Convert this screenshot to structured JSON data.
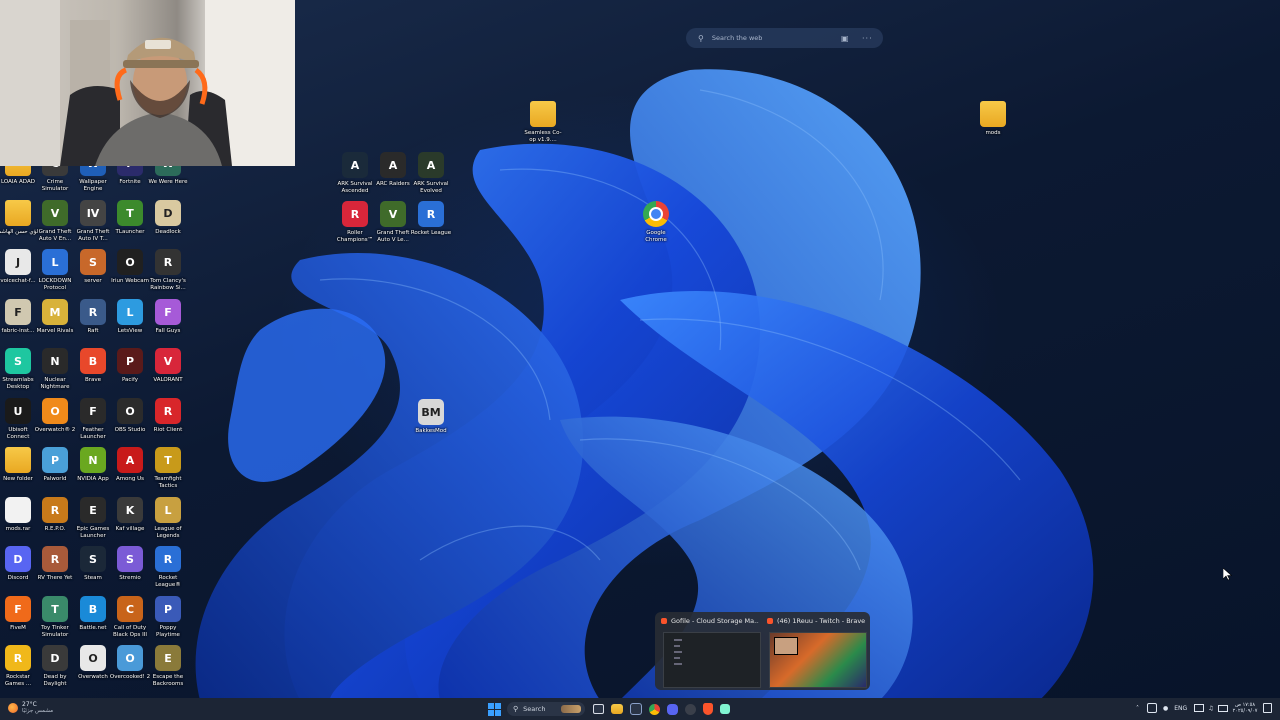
{
  "desktop_icons_left": [
    {
      "label": "LOAIA ADAD",
      "color": "#e9a822",
      "glyph": "",
      "kind": "folder"
    },
    {
      "label": "Crime Simulator",
      "color": "#3a3a3a",
      "glyph": "C"
    },
    {
      "label": "Wallpaper Engine",
      "color": "#1f5fb8",
      "glyph": "W"
    },
    {
      "label": "Fortnite",
      "color": "#2b2b6b",
      "glyph": "F"
    },
    {
      "label": "We Were Here",
      "color": "#2c6b5a",
      "glyph": "W"
    },
    {
      "label": "لؤي حسن الهاشم",
      "color": "#e9a822",
      "glyph": "",
      "kind": "folder"
    },
    {
      "label": "Grand Theft Auto V En...",
      "color": "#3f6b2a",
      "glyph": "V"
    },
    {
      "label": "Grand Theft Auto IV T...",
      "color": "#444444",
      "glyph": "IV"
    },
    {
      "label": "TLauncher",
      "color": "#3c8a2c",
      "glyph": "T"
    },
    {
      "label": "Deadlock",
      "color": "#d9c9a0",
      "glyph": "D"
    },
    {
      "label": "voicechat-f...",
      "color": "#e8e8e8",
      "glyph": "J"
    },
    {
      "label": "LOCKDOWN Protocol",
      "color": "#2a6fd6",
      "glyph": "L"
    },
    {
      "label": "server",
      "color": "#c8682a",
      "glyph": "S"
    },
    {
      "label": "Iriun Webcam",
      "color": "#202020",
      "glyph": "O"
    },
    {
      "label": "Tom Clancy's Rainbow Si...",
      "color": "#333333",
      "glyph": "R"
    },
    {
      "label": "fabric-inst...",
      "color": "#d0c8b0",
      "glyph": "F"
    },
    {
      "label": "Marvel Rivals",
      "color": "#d8b23a",
      "glyph": "M"
    },
    {
      "label": "Raft",
      "color": "#3a5a8a",
      "glyph": "R"
    },
    {
      "label": "LetsView",
      "color": "#2d9be0",
      "glyph": "L"
    },
    {
      "label": "Fall Guys",
      "color": "#a65ad8",
      "glyph": "F"
    },
    {
      "label": "Streamlabs Desktop",
      "color": "#1ec7a0",
      "glyph": "S"
    },
    {
      "label": "Nuclear Nightmare",
      "color": "#2a2a2a",
      "glyph": "N"
    },
    {
      "label": "Brave",
      "color": "#e8482b",
      "glyph": "B"
    },
    {
      "label": "Pacify",
      "color": "#5a1a1a",
      "glyph": "P"
    },
    {
      "label": "VALORANT",
      "color": "#d8263a",
      "glyph": "V"
    },
    {
      "label": "Ubisoft Connect",
      "color": "#1a1a1a",
      "glyph": "U"
    },
    {
      "label": "Overwatch® 2",
      "color": "#f08a1a",
      "glyph": "O"
    },
    {
      "label": "Feather Launcher",
      "color": "#2a2a2a",
      "glyph": "F"
    },
    {
      "label": "OBS Studio",
      "color": "#2b2b2b",
      "glyph": "O"
    },
    {
      "label": "Riot Client",
      "color": "#d8262a",
      "glyph": "R"
    },
    {
      "label": "New folder",
      "color": "#e9a822",
      "glyph": "",
      "kind": "folder"
    },
    {
      "label": "Palworld",
      "color": "#4aa0d8",
      "glyph": "P"
    },
    {
      "label": "NVIDIA App",
      "color": "#6aa820",
      "glyph": "N"
    },
    {
      "label": "Among Us",
      "color": "#c81a1a",
      "glyph": "A"
    },
    {
      "label": "Teamfight Tactics",
      "color": "#c89a1a",
      "glyph": "T"
    },
    {
      "label": "mods.rar",
      "color": "#f2f2f2",
      "glyph": ""
    },
    {
      "label": "R.E.P.O.",
      "color": "#c87a1a",
      "glyph": "R"
    },
    {
      "label": "Epic Games Launcher",
      "color": "#2a2a2a",
      "glyph": "E"
    },
    {
      "label": "Kaf village",
      "color": "#3a3a3a",
      "glyph": "K"
    },
    {
      "label": "League of Legends",
      "color": "#c8a040",
      "glyph": "L"
    },
    {
      "label": "Discord",
      "color": "#5865f2",
      "glyph": "D"
    },
    {
      "label": "RV There Yet",
      "color": "#a85a3a",
      "glyph": "R"
    },
    {
      "label": "Steam",
      "color": "#1b2838",
      "glyph": "S"
    },
    {
      "label": "Stremio",
      "color": "#7b5bd6",
      "glyph": "S"
    },
    {
      "label": "Rocket League®",
      "color": "#2a6fd6",
      "glyph": "R"
    },
    {
      "label": "FiveM",
      "color": "#f06a1a",
      "glyph": "F"
    },
    {
      "label": "Toy Tinker Simulator",
      "color": "#3a8a6a",
      "glyph": "T"
    },
    {
      "label": "Battle.net",
      "color": "#1a8ad8",
      "glyph": "B"
    },
    {
      "label": "Call of Duty Black Ops III",
      "color": "#c8641a",
      "glyph": "C"
    },
    {
      "label": "Poppy Playtime",
      "color": "#3a5ab8",
      "glyph": "P"
    },
    {
      "label": "Rockstar Games ...",
      "color": "#f0b81a",
      "glyph": "R"
    },
    {
      "label": "Dead by Daylight",
      "color": "#3a3a3a",
      "glyph": "D"
    },
    {
      "label": "Overwatch",
      "color": "#e8e8e8",
      "glyph": "O"
    },
    {
      "label": "Overcooked! 2",
      "color": "#4a9ad8",
      "glyph": "O"
    },
    {
      "label": "Escape the Backrooms",
      "color": "#8a7a3a",
      "glyph": "E"
    }
  ],
  "desktop_icons_center": [
    {
      "label": "ARK Survival Ascended",
      "color": "#1a2a3a",
      "glyph": "A",
      "col": 0,
      "row": 0
    },
    {
      "label": "ARC Raiders",
      "color": "#2a2a2a",
      "glyph": "A",
      "col": 1,
      "row": 0
    },
    {
      "label": "ARK Survival Evolved",
      "color": "#2a3a2a",
      "glyph": "A",
      "col": 2,
      "row": 0
    },
    {
      "label": "Roller Champions™",
      "color": "#d8263a",
      "glyph": "R",
      "col": 0,
      "row": 1
    },
    {
      "label": "Grand Theft Auto V Le...",
      "color": "#3f6b2a",
      "glyph": "V",
      "col": 1,
      "row": 1
    },
    {
      "label": "Rocket League",
      "color": "#2a6fd6",
      "glyph": "R",
      "col": 2,
      "row": 1
    }
  ],
  "desktop_icons_free": [
    {
      "label": "Seamless Co-op v1.9....",
      "color": "#e9a822",
      "glyph": "",
      "kind": "folder",
      "name": "seamless-coop-folder"
    },
    {
      "label": "mods",
      "color": "#e9a822",
      "glyph": "",
      "kind": "folder",
      "name": "mods-folder"
    },
    {
      "label": "Google Chrome",
      "color": "#ffffff",
      "glyph": "",
      "kind": "chrome",
      "name": "google-chrome-shortcut"
    },
    {
      "label": "BakkesMod",
      "color": "#d8d8d8",
      "glyph": "BM",
      "name": "bakkesmod-shortcut"
    }
  ],
  "search_widget": {
    "placeholder": "Search the web"
  },
  "taskbar": {
    "search_label": "Search",
    "weather_temp": "27°C",
    "weather_desc": "مشمس جزئيًا",
    "language": "ENG",
    "time": "١٧:٥٨ ص",
    "date": "٢٠٢٥/٠٩/٠٧"
  },
  "thumbnails": [
    {
      "title": "Gofile - Cloud Storage Ma..."
    },
    {
      "title": "(46) 1Reuu - Twitch - Brave"
    }
  ],
  "colors": {
    "brave": "#fb542b",
    "taskbar": "#1c2535"
  }
}
